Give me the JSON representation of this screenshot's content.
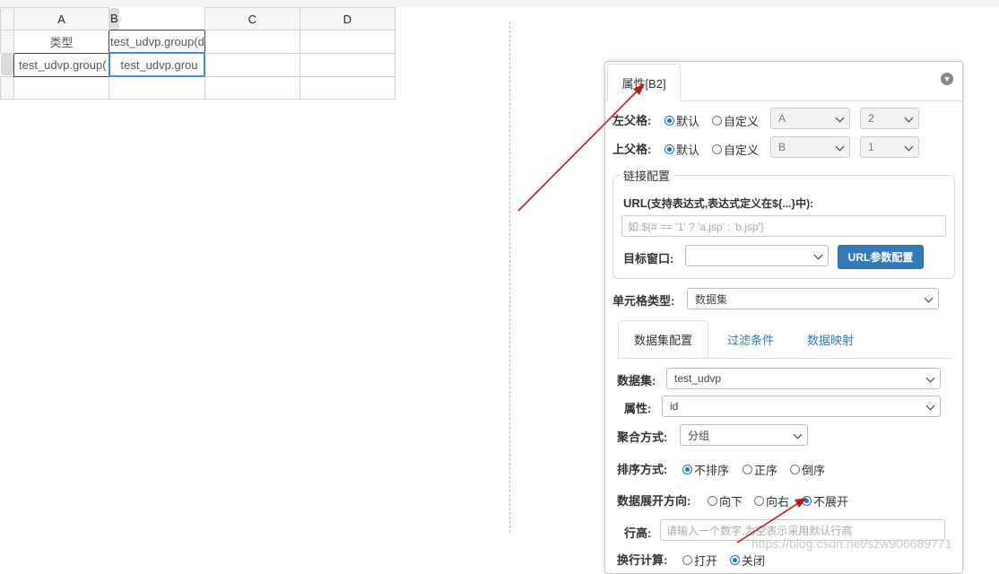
{
  "sheet": {
    "columns": [
      "A",
      "B",
      "C",
      "D"
    ],
    "cells": {
      "a1": "类型",
      "b1": "test_udvp.group(d",
      "a2": "test_udvp.group(",
      "b2": "test_udvp.grou"
    }
  },
  "panel": {
    "tab_title": "属性[B2]",
    "left_parent": {
      "label": "左父格:",
      "default_label": "默认",
      "custom_label": "自定义",
      "col_value": "A",
      "row_value": "2"
    },
    "top_parent": {
      "label": "上父格:",
      "default_label": "默认",
      "custom_label": "自定义",
      "col_value": "B",
      "row_value": "1"
    },
    "link_config": {
      "legend": "链接配置",
      "url_label": "URL",
      "url_hint": "(支持表达式,表达式定义在${...}中):",
      "url_placeholder": "如:${# == '1' ? 'a.jsp' : 'b.jsp'}",
      "target_label": "目标窗口:",
      "target_value": "",
      "url_params_button": "URL参数配置"
    },
    "cell_type": {
      "label": "单元格类型:",
      "value": "数据集"
    },
    "tabs": [
      "数据集配置",
      "过滤条件",
      "数据映射"
    ],
    "dataset": {
      "dataset_label": "数据集:",
      "dataset_value": "test_udvp",
      "attr_label": "属性:",
      "attr_value": "id",
      "agg_label": "聚合方式:",
      "agg_value": "分组",
      "sort_label": "排序方式:",
      "sort_options": [
        "不排序",
        "正序",
        "倒序"
      ],
      "sort_selected": "不排序",
      "expand_label": "数据展开方向:",
      "expand_options": [
        "向下",
        "向右",
        "不展开"
      ],
      "expand_selected": "不展开",
      "row_height_label": "行高:",
      "row_height_placeholder": "请输入一个数字,为空表示采用默认行高",
      "wrap_label": "换行计算:",
      "wrap_options": [
        "打开",
        "关闭"
      ],
      "wrap_selected": "关闭"
    }
  },
  "watermark": "https://blog.csdn.net/szw906689771",
  "colors": {
    "accent": "#337ab7",
    "radio_checked": "#1a73e8",
    "arrow": "#b71c1c",
    "selection": "#3d8be0"
  }
}
